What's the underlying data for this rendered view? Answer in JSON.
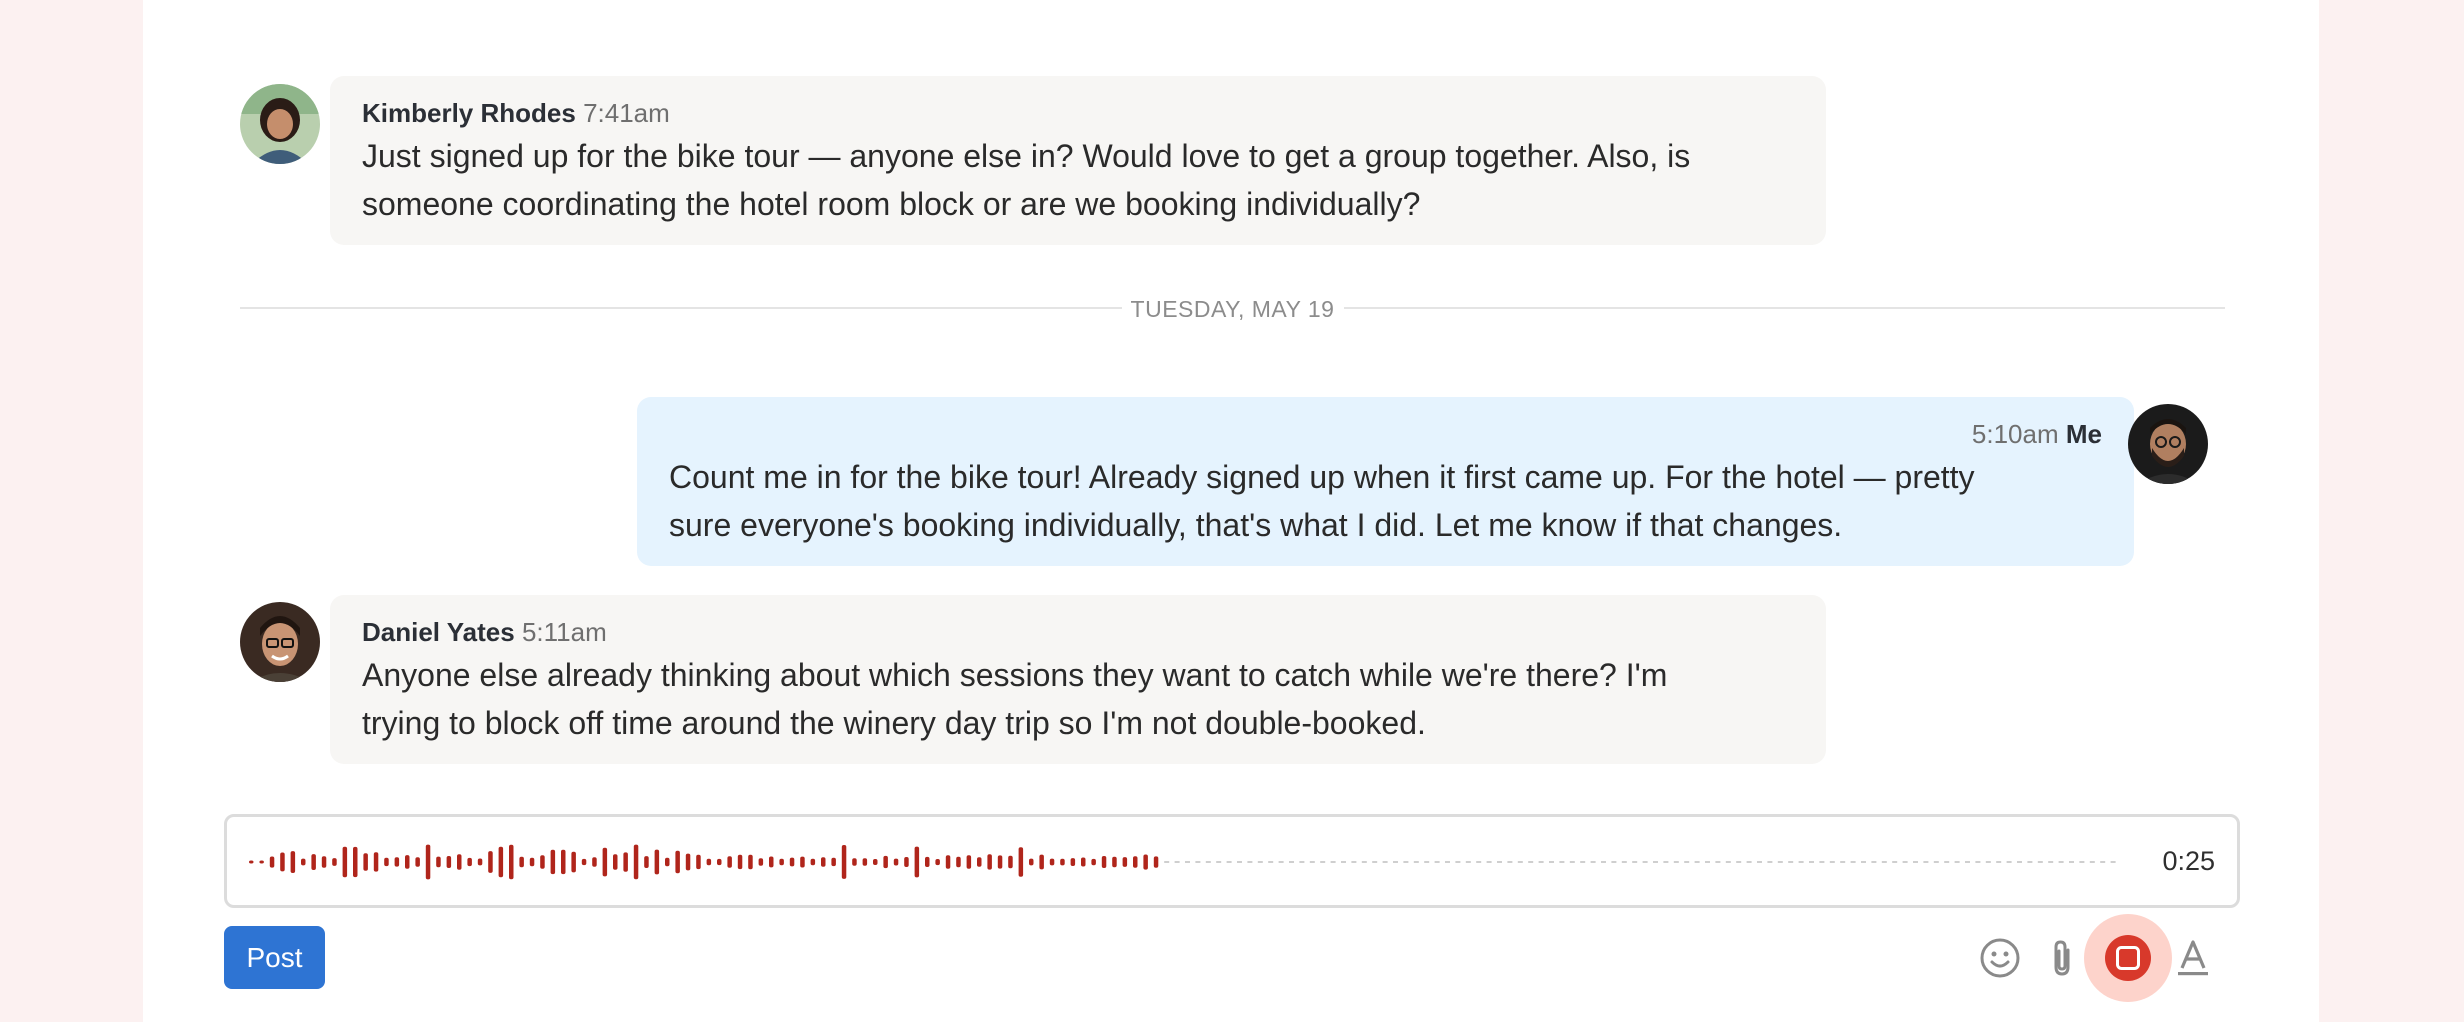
{
  "messages": [
    {
      "author": "Kimberly Rhodes",
      "time": "7:41am",
      "lines": [
        "Just signed up for the bike tour — anyone else in? Would love to get a group together. Also, is",
        "someone coordinating the hotel room block or are we booking individually?"
      ]
    },
    {
      "author": "Me",
      "time": "5:10am",
      "lines": [
        "Count me in for the bike tour! Already signed up when it first came up. For the hotel — pretty",
        "sure everyone's booking individually, that's what I did. Let me know if that changes."
      ]
    },
    {
      "author": "Daniel Yates",
      "time": "5:11am",
      "lines": [
        "Anyone else already thinking about which sessions they want to catch while we're there? I'm",
        "trying to block off time around the winery day trip so I'm not double-booked."
      ]
    }
  ],
  "divider": {
    "label": "TUESDAY, MAY 19"
  },
  "recorder": {
    "elapsed": "0:25",
    "recorded_fraction": 0.49,
    "colors": {
      "recorded": "#b0251b",
      "pending": "#cfcfcf"
    }
  },
  "composer": {
    "post_label": "Post",
    "tools": [
      "emoji-icon",
      "attachment-icon",
      "stop-recording-icon",
      "text-format-icon"
    ]
  },
  "colors": {
    "accent": "#2e74d3",
    "own_bubble": "#e5f3fe",
    "other_bubble": "#f7f6f4",
    "record_red": "#d8392b"
  }
}
